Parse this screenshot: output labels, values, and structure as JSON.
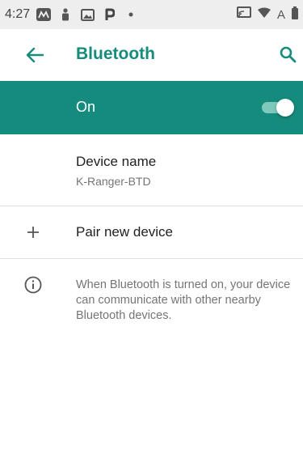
{
  "status_bar": {
    "time": "4:27",
    "notification_icons": [
      "m-app-icon",
      "person-icon",
      "image-icon",
      "p-app-icon",
      "dot-icon"
    ],
    "system_icons": [
      "cast-icon",
      "wifi-icon",
      "auto-icon",
      "battery-icon"
    ],
    "auto_label": "A"
  },
  "app_bar": {
    "title": "Bluetooth",
    "accent_color": "#158c7c"
  },
  "bluetooth_toggle": {
    "label": "On",
    "enabled": true,
    "bar_color": "#148b7c"
  },
  "device_name": {
    "title": "Device name",
    "value": "K-Ranger-BTD"
  },
  "pair_new_device": {
    "label": "Pair new device"
  },
  "info": {
    "text": "When Bluetooth is turned on, your device can communicate with other nearby Bluetooth devices."
  }
}
